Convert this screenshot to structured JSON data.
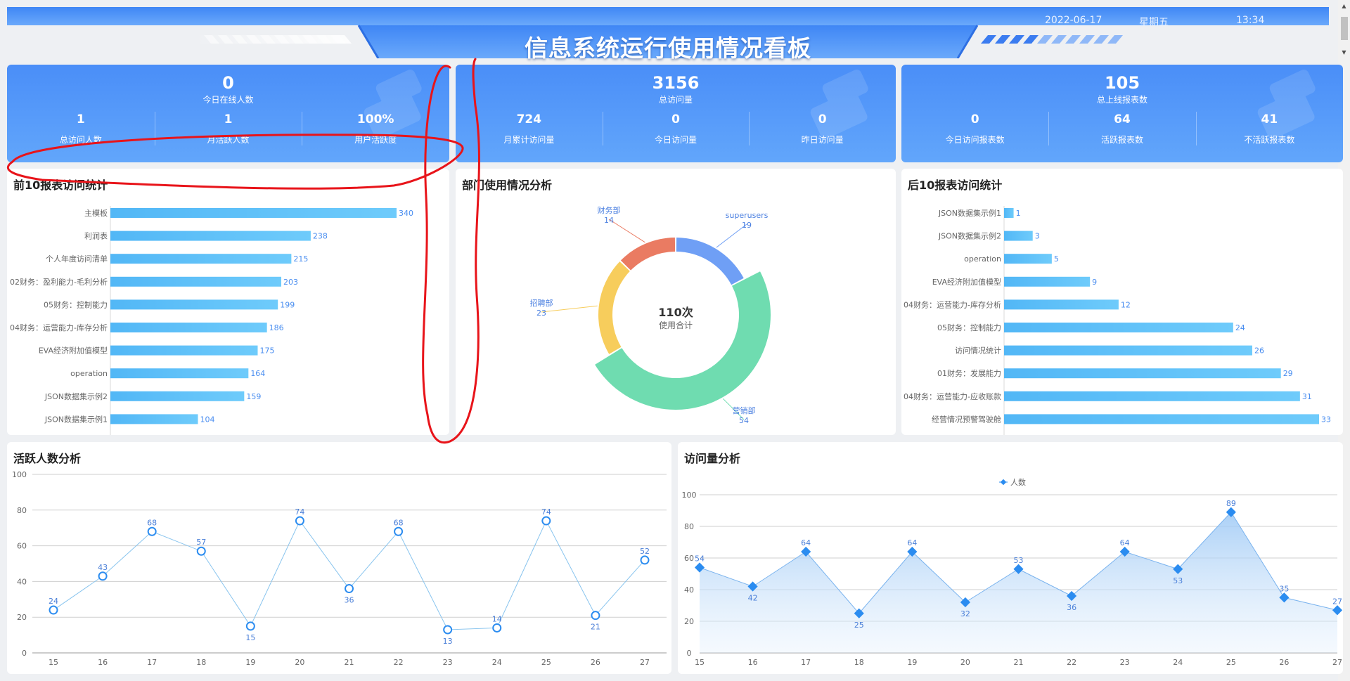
{
  "header": {
    "title": "信息系统运行使用情况看板",
    "date": "2022-06-17",
    "weekday": "星期五",
    "time": "13:34"
  },
  "kpi": [
    {
      "main": {
        "value": "0",
        "label": "今日在线人数"
      },
      "subs": [
        {
          "value": "1",
          "label": "总访问人数"
        },
        {
          "value": "1",
          "label": "月活跃人数"
        },
        {
          "value": "100%",
          "label": "用户活跃度"
        }
      ]
    },
    {
      "main": {
        "value": "3156",
        "label": "总访问量"
      },
      "subs": [
        {
          "value": "724",
          "label": "月累计访问量"
        },
        {
          "value": "0",
          "label": "今日访问量"
        },
        {
          "value": "0",
          "label": "昨日访问量"
        }
      ]
    },
    {
      "main": {
        "value": "105",
        "label": "总上线报表数"
      },
      "subs": [
        {
          "value": "0",
          "label": "今日访问报表数"
        },
        {
          "value": "64",
          "label": "活跃报表数"
        },
        {
          "value": "41",
          "label": "不活跃报表数"
        }
      ]
    }
  ],
  "panels": {
    "top10": "前10报表访问统计",
    "dept": "部门使用情况分析",
    "bottom10": "后10报表访问统计",
    "active": "活跃人数分析",
    "visits": "访问量分析"
  },
  "colors": {
    "header": "#4b90f7",
    "kpi": "#4a8ef8",
    "bar": "#5ec2f8",
    "line": "#2b8cf0",
    "annotation": "#e8141a"
  },
  "chart_data": [
    {
      "type": "bar",
      "title": "前10报表访问统计",
      "orientation": "horizontal",
      "categories": [
        "主模板",
        "利润表",
        "个人年度访问清单",
        "02财务：盈利能力-毛利分析",
        "05财务：控制能力",
        "04财务：运营能力-库存分析",
        "EVA经济附加值模型",
        "operation",
        "JSON数据集示例2",
        "JSON数据集示例1"
      ],
      "values": [
        340,
        238,
        215,
        203,
        199,
        186,
        175,
        164,
        159,
        104
      ],
      "xlim": [
        0,
        340
      ]
    },
    {
      "type": "pie",
      "title": "部门使用情况分析",
      "center_value": "110次",
      "center_label": "使用合计",
      "slices": [
        {
          "name": "superusers",
          "value": 19,
          "color": "#6f9ff5"
        },
        {
          "name": "营销部",
          "value": 54,
          "color": "#6fdcb0"
        },
        {
          "name": "招聘部",
          "value": 23,
          "color": "#f7cd5c"
        },
        {
          "name": "财务部",
          "value": 14,
          "color": "#ea7b62"
        }
      ]
    },
    {
      "type": "bar",
      "title": "后10报表访问统计",
      "orientation": "horizontal",
      "categories": [
        "JSON数据集示例1",
        "JSON数据集示例2",
        "operation",
        "EVA经济附加值模型",
        "04财务：运营能力-库存分析",
        "05财务：控制能力",
        "访问情况统计",
        "01财务：发展能力",
        "04财务：运营能力-应收账款",
        "经营情况预警驾驶舱"
      ],
      "values": [
        1,
        3,
        5,
        9,
        12,
        24,
        26,
        29,
        31,
        33
      ],
      "xlim": [
        0,
        33
      ]
    },
    {
      "type": "line",
      "title": "活跃人数分析",
      "x": [
        "15",
        "16",
        "17",
        "18",
        "19",
        "20",
        "21",
        "22",
        "23",
        "24",
        "25",
        "26",
        "27"
      ],
      "values": [
        24,
        43,
        68,
        57,
        15,
        74,
        36,
        68,
        13,
        14,
        74,
        21,
        52
      ],
      "ylim": [
        0,
        100
      ],
      "yticks": [
        0,
        20,
        40,
        60,
        80,
        100
      ],
      "grid": true
    },
    {
      "type": "area",
      "title": "访问量分析",
      "x": [
        "15",
        "16",
        "17",
        "18",
        "19",
        "20",
        "21",
        "22",
        "23",
        "24",
        "25",
        "26",
        "27"
      ],
      "series": [
        {
          "name": "人数",
          "values": [
            54,
            42,
            64,
            25,
            64,
            32,
            53,
            36,
            64,
            53,
            89,
            35,
            27
          ]
        }
      ],
      "ylim": [
        0,
        100
      ],
      "yticks": [
        0,
        20,
        40,
        60,
        80,
        100
      ],
      "grid": true,
      "legend": "top-center"
    }
  ]
}
